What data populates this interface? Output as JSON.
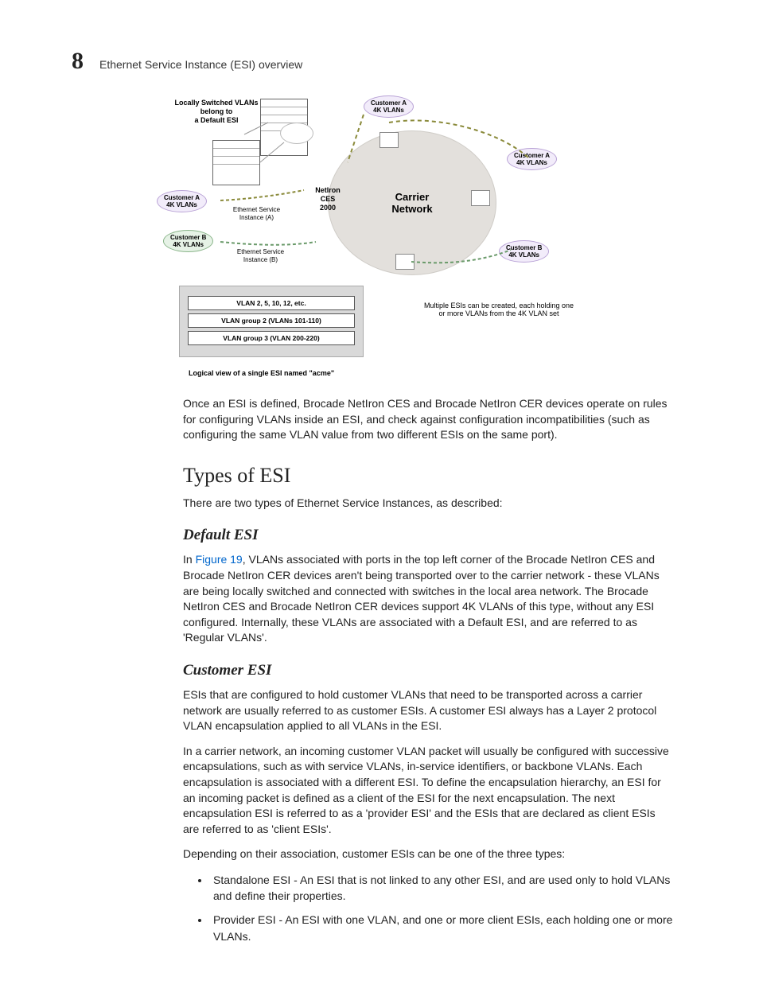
{
  "header": {
    "chapter_number": "8",
    "section_title": "Ethernet Service Instance (ESI) overview"
  },
  "diagram": {
    "locally_switched": "Locally Switched VLANs\nbelong to\na Default ESI",
    "customer_a": "Customer A\n4K VLANs",
    "customer_b": "Customer B\n4K VLANs",
    "esi_a": "Ethernet Service\nInstance (A)",
    "esi_b": "Ethernet Service\nInstance (B)",
    "netiron": "NetIron\nCES\n2000",
    "carrier": "Carrier\nNetwork",
    "multi_esi_note": "Multiple ESIs can be created, each holding one\nor more VLANs from the 4K VLAN set",
    "vlan_items": [
      "VLAN 2, 5, 10, 12, etc.",
      "VLAN group 2 (VLANs 101-110)",
      "VLAN group 3 (VLAN 200-220)"
    ],
    "logical_caption": "Logical view of a single ESI named \"acme\""
  },
  "intro_paragraph": "Once an ESI is defined, Brocade NetIron CES and Brocade NetIron CER devices operate on rules for configuring VLANs inside an ESI, and check against configuration incompatibilities (such as configuring the same VLAN value from two different ESIs on the same port).",
  "types_heading": "Types of ESI",
  "types_intro": "There are two types of Ethernet Service Instances, as described:",
  "default_heading": "Default ESI",
  "default_paragraph_pre": "In ",
  "default_figure_link": "Figure 19",
  "default_paragraph_post": ", VLANs associated with ports in the top left corner of the Brocade NetIron CES and Brocade NetIron CER devices aren't being transported over to the carrier network - these VLANs are being locally switched and connected with switches in the local area network. The Brocade NetIron CES and Brocade NetIron CER devices support 4K VLANs of this type, without any ESI configured. Internally, these VLANs are associated with a Default ESI, and are referred to as 'Regular VLANs'.",
  "customer_heading": "Customer ESI",
  "customer_p1": "ESIs that are configured to hold customer VLANs that need to be transported across a carrier network are usually referred to as customer ESIs. A customer ESI always has a Layer 2 protocol VLAN encapsulation applied to all VLANs in the ESI.",
  "customer_p2": "In a carrier network, an incoming customer VLAN packet will usually be configured with successive encapsulations, such as with service VLANs, in-service identifiers, or backbone VLANs. Each encapsulation is associated with a different ESI. To define the encapsulation hierarchy, an ESI for an incoming packet is defined as a client of the ESI for the next encapsulation. The next encapsulation ESI is referred to as a 'provider ESI' and the ESIs that are declared as client ESIs are referred to as 'client ESIs'.",
  "customer_p3": "Depending on their association, customer ESIs can be one of the three types:",
  "bullets": [
    "Standalone ESI - An ESI that is not linked to any other ESI, and are used only to hold VLANs and define their properties.",
    "Provider ESI - An ESI with one VLAN, and one or more client ESIs, each holding one or more VLANs."
  ]
}
